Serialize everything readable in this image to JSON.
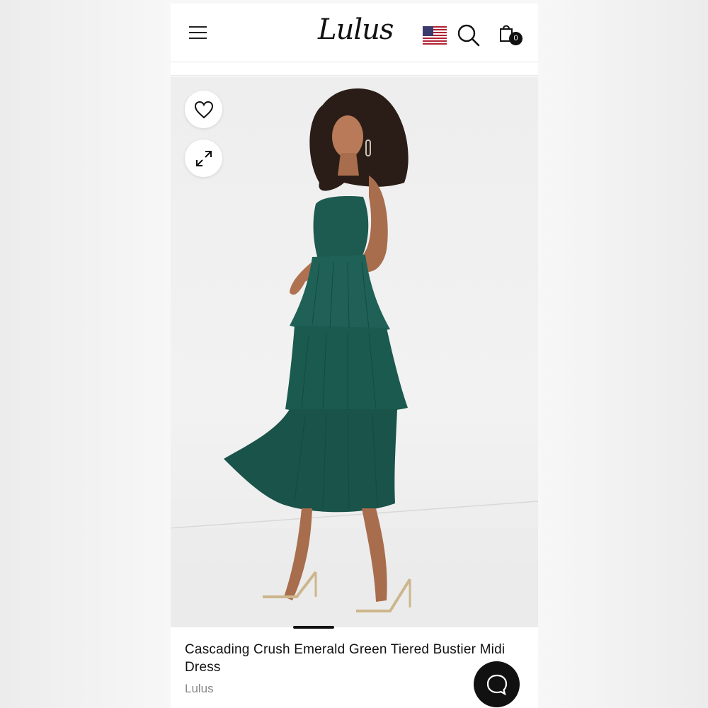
{
  "header": {
    "logo_text": "Lulus",
    "cart_count": "0",
    "icons": {
      "menu": "hamburger-menu-icon",
      "flag": "us-flag-icon",
      "search": "search-icon",
      "cart": "shopping-bag-icon"
    }
  },
  "gallery": {
    "actions": [
      "heart-icon",
      "expand-icon"
    ],
    "dress_color": "#1d5a50"
  },
  "product": {
    "title": "Cascading Crush Emerald Green Tiered Bustier Midi Dress",
    "brand": "Lulus"
  },
  "chat": {
    "icon": "chat-bubble-icon"
  }
}
